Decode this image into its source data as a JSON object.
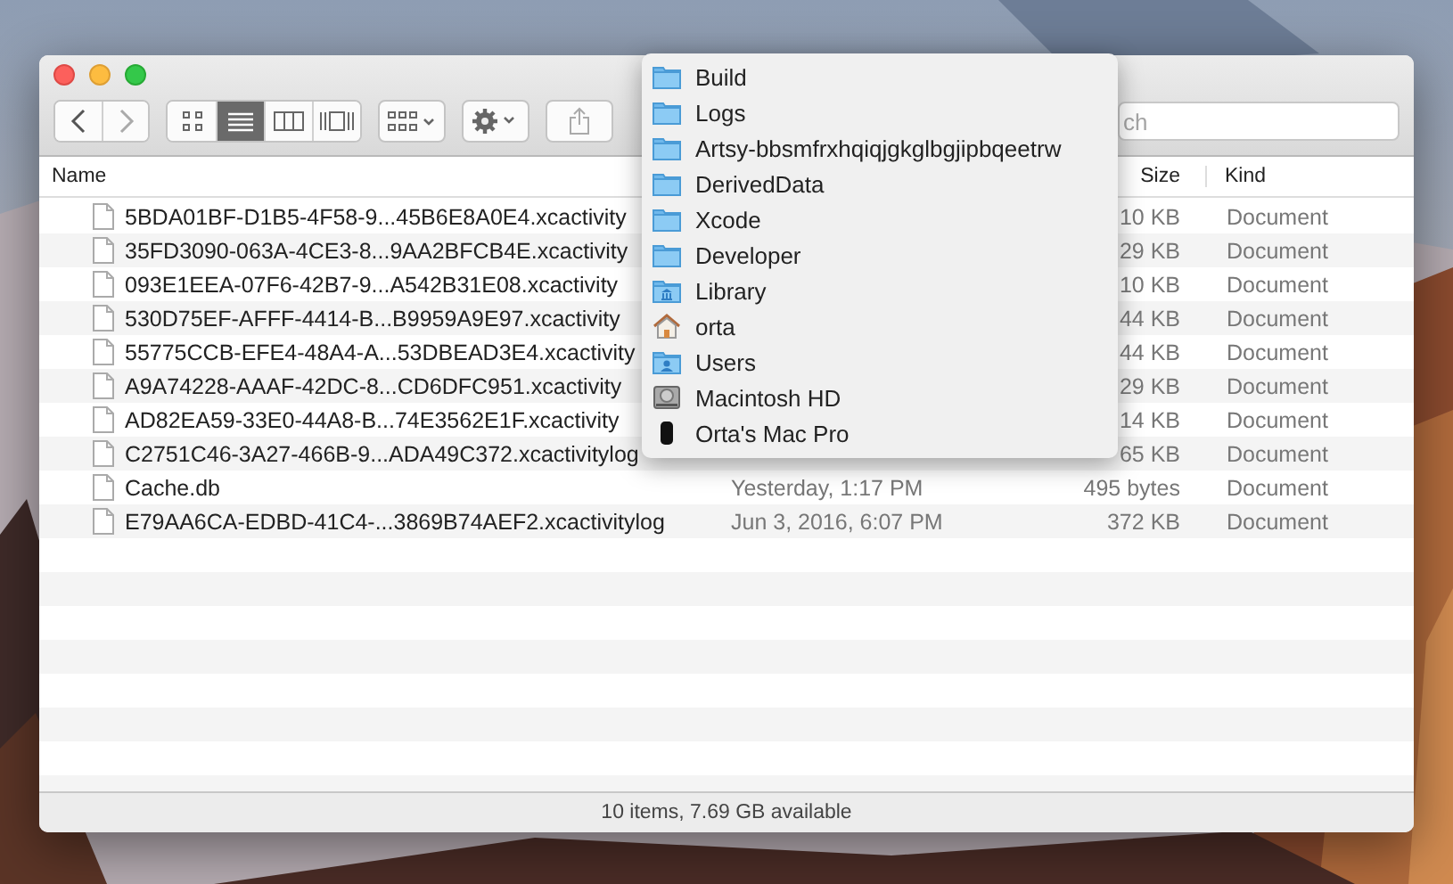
{
  "toolbar": {
    "view_modes": [
      {
        "kind": "icons",
        "selected": false
      },
      {
        "kind": "list",
        "selected": true
      },
      {
        "kind": "columns",
        "selected": false
      },
      {
        "kind": "coverflow",
        "selected": false
      }
    ],
    "search": {
      "placeholder": "ch"
    }
  },
  "table": {
    "columns": [
      {
        "label": "Name"
      },
      {
        "label": "Size"
      },
      {
        "label": "Kind"
      }
    ],
    "rows": [
      {
        "name": "5BDA01BF-D1B5-4F58-9...45B6E8A0E4.xcactivity",
        "date": "",
        "size": "10 KB",
        "kind": "Document"
      },
      {
        "name": "35FD3090-063A-4CE3-8...9AA2BFCB4E.xcactivity",
        "date": "",
        "size": "29 KB",
        "kind": "Document"
      },
      {
        "name": "093E1EEA-07F6-42B7-9...A542B31E08.xcactivity",
        "date": "",
        "size": "10 KB",
        "kind": "Document"
      },
      {
        "name": "530D75EF-AFFF-4414-B...B9959A9E97.xcactivity",
        "date": "",
        "size": "44 KB",
        "kind": "Document"
      },
      {
        "name": "55775CCB-EFE4-48A4-A...53DBEAD3E4.xcactivity",
        "date": "",
        "size": "44 KB",
        "kind": "Document"
      },
      {
        "name": "A9A74228-AAAF-42DC-8...CD6DFC951.xcactivity",
        "date": "",
        "size": "29 KB",
        "kind": "Document"
      },
      {
        "name": "AD82EA59-33E0-44A8-B...74E3562E1F.xcactivity",
        "date": "",
        "size": "14 KB",
        "kind": "Document"
      },
      {
        "name": "C2751C46-3A27-466B-9...ADA49C372.xcactivitylog",
        "date": "",
        "size": "65 KB",
        "kind": "Document"
      },
      {
        "name": "Cache.db",
        "date": "Yesterday, 1:17 PM",
        "size": "495 bytes",
        "kind": "Document"
      },
      {
        "name": "E79AA6CA-EDBD-41C4-...3869B74AEF2.xcactivitylog",
        "date": "Jun 3, 2016, 6:07 PM",
        "size": "372 KB",
        "kind": "Document"
      }
    ]
  },
  "status_bar": "10 items, 7.69 GB available",
  "path_menu": {
    "items": [
      {
        "label": "Build",
        "kind": "folder"
      },
      {
        "label": "Logs",
        "kind": "folder"
      },
      {
        "label": "Artsy-bbsmfrxhqiqjgkglbgjipbqeetrw",
        "kind": "folder"
      },
      {
        "label": "DerivedData",
        "kind": "folder"
      },
      {
        "label": "Xcode",
        "kind": "folder"
      },
      {
        "label": "Developer",
        "kind": "folder"
      },
      {
        "label": "Library",
        "kind": "library"
      },
      {
        "label": "orta",
        "kind": "home"
      },
      {
        "label": "Users",
        "kind": "users"
      },
      {
        "label": "Macintosh HD",
        "kind": "disk"
      },
      {
        "label": "Orta's Mac Pro",
        "kind": "computer"
      }
    ]
  }
}
